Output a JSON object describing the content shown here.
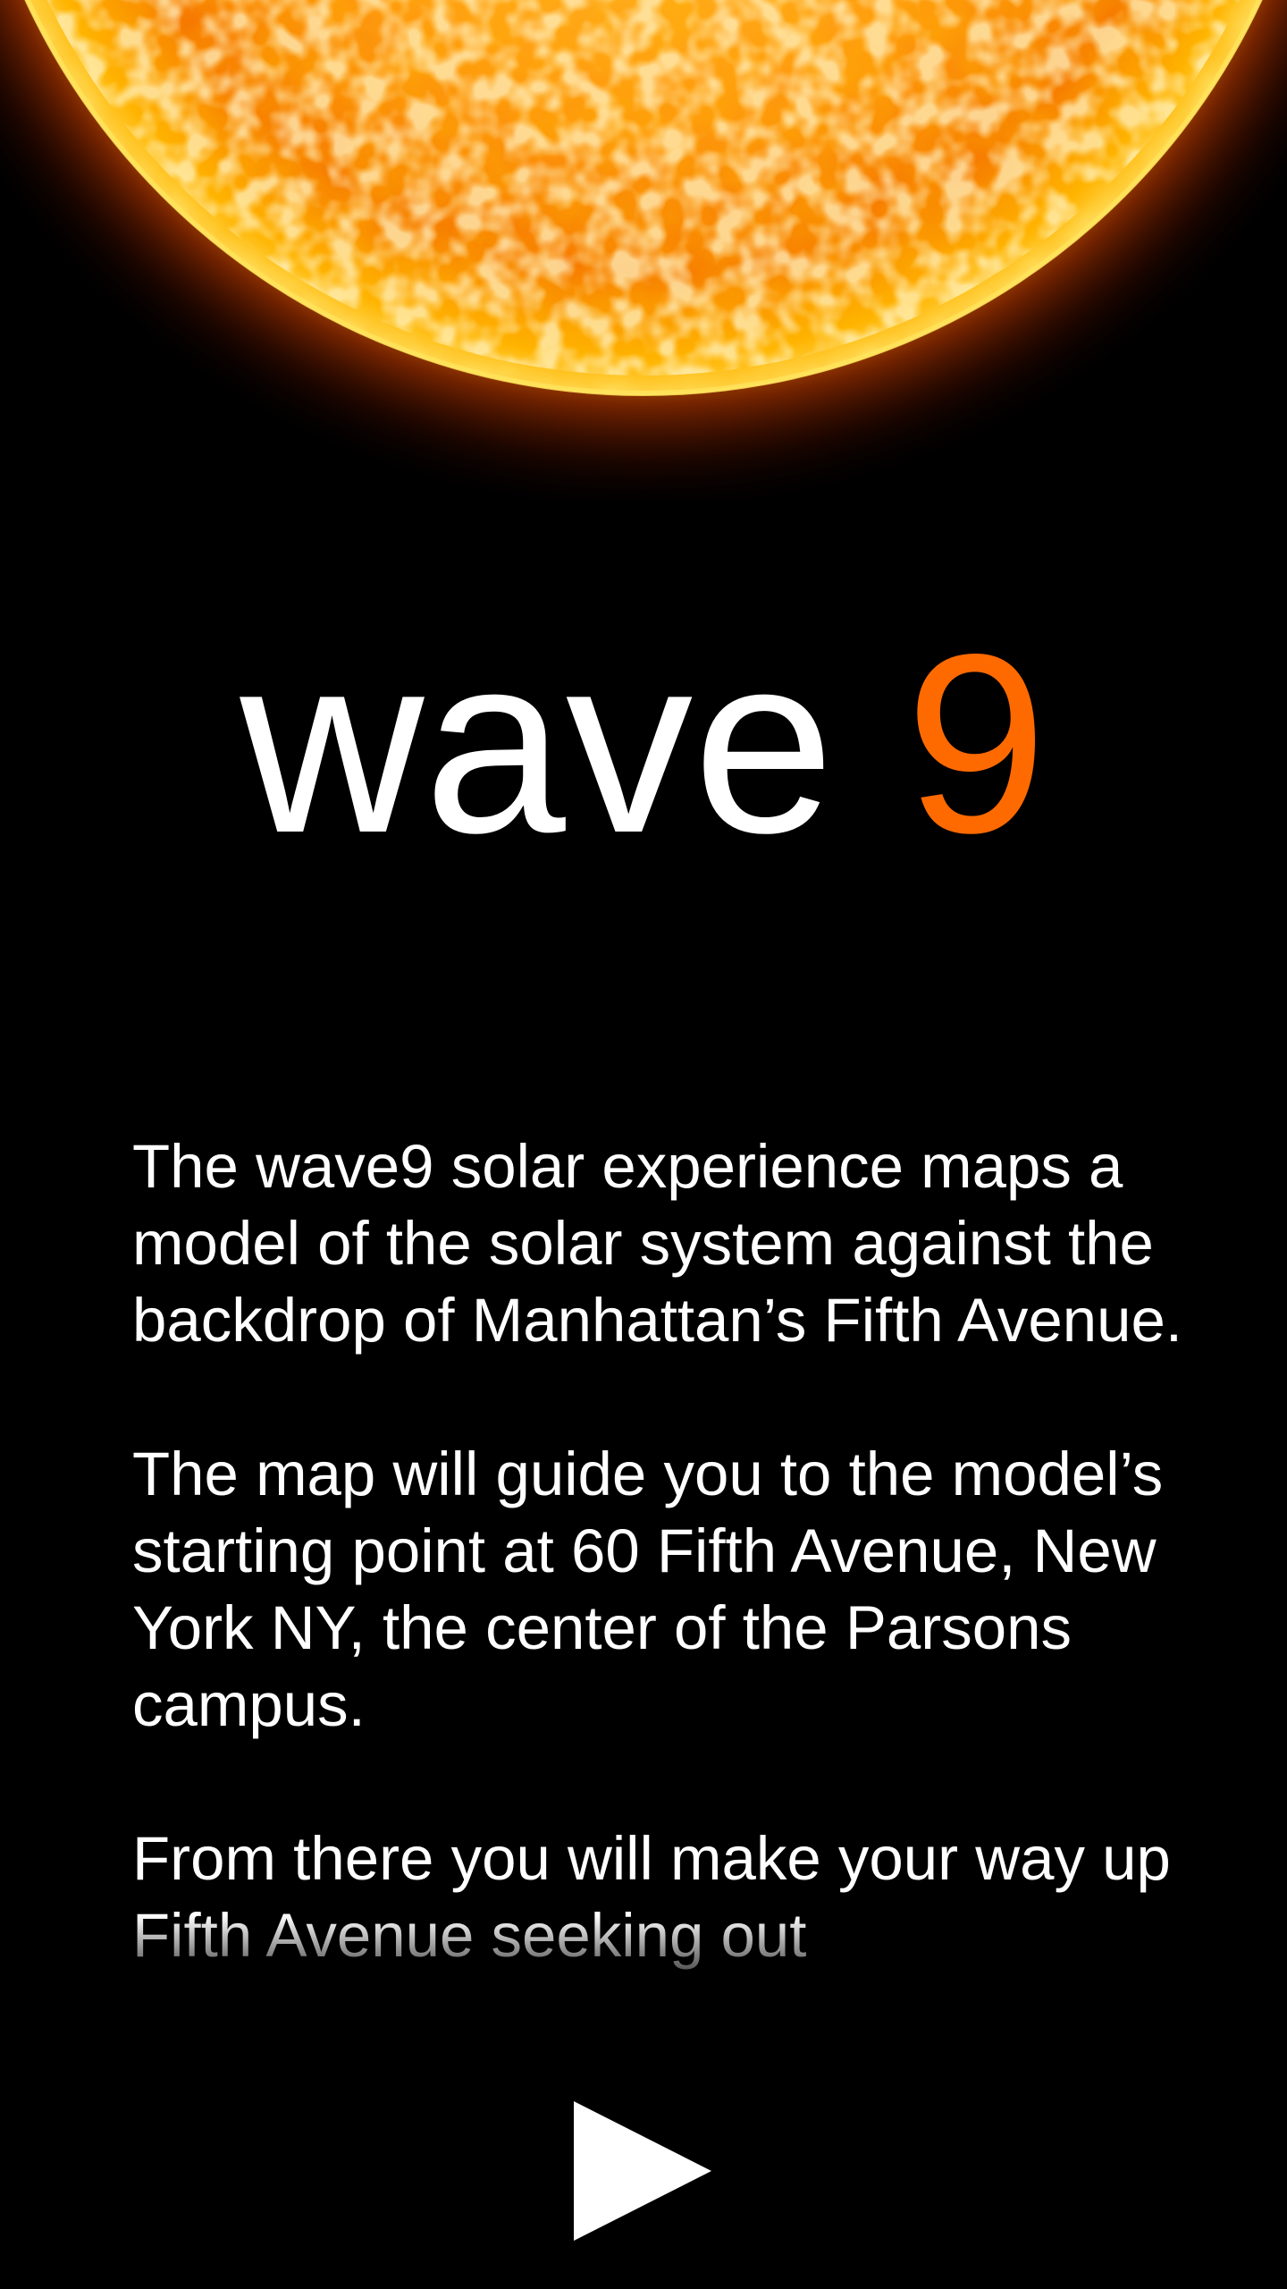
{
  "header": {
    "image": "sun-surface",
    "colors": {
      "glow_core": "#ffb000",
      "glow_mid": "#ff7a00",
      "glow_edge": "#ffd84a",
      "background": "#000000"
    }
  },
  "logo": {
    "word": "wave",
    "number": "9",
    "word_color": "#ffffff",
    "number_color": "#ff6a00"
  },
  "intro": {
    "paragraphs": [
      "The wave9 solar experience maps a model of the solar system against the backdrop of Manhattan’s Fifth Avenue.",
      "The map will guide you to the model’s starting point at 60 Fifth Avenue, New York NY, the center of the Parsons campus.",
      "From there you will make your way up Fifth Avenue seeking out"
    ]
  },
  "controls": {
    "play_icon": "play-icon"
  }
}
